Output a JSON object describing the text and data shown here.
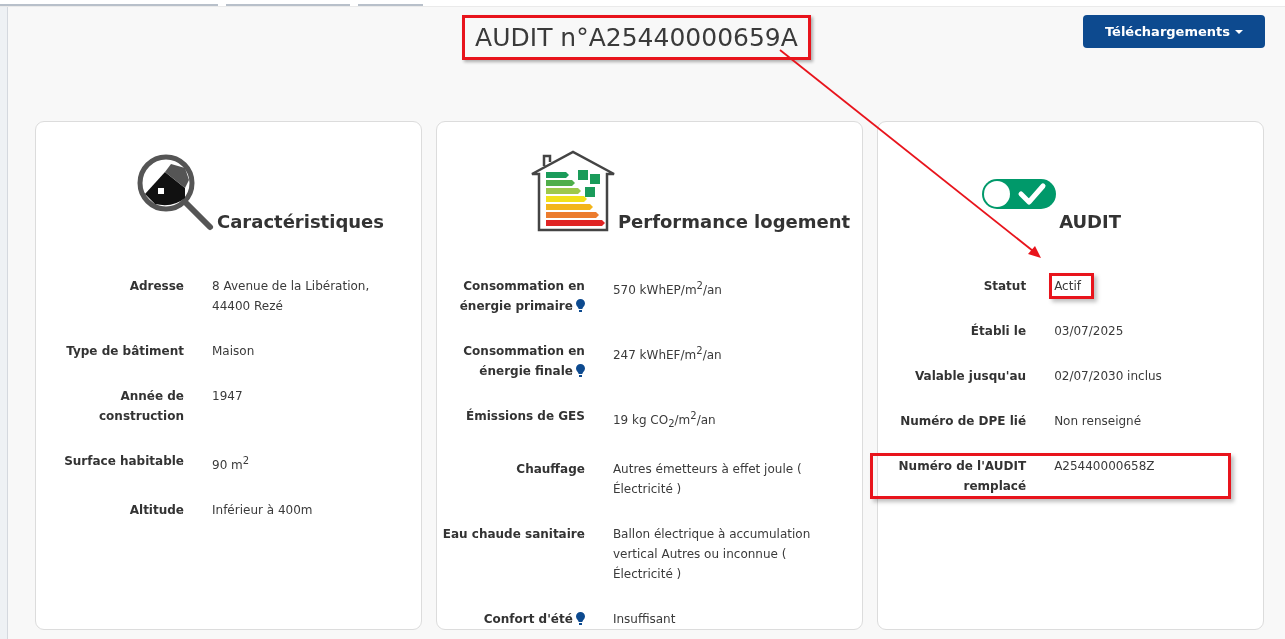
{
  "title": {
    "text": "AUDIT n°A25440000659A",
    "highlighted": true
  },
  "download_button": {
    "label": "Téléchargements"
  },
  "cards": [
    {
      "kind": "search-house",
      "title": "Caractéristiques",
      "rows": [
        {
          "label": "Adresse",
          "value": "8 Avenue de la Libération, 44400 Rezé",
          "hint_icon": false,
          "value_highlighted": false,
          "row_highlighted": false
        },
        {
          "label": "Type de bâtiment",
          "value": "Maison",
          "hint_icon": false,
          "value_highlighted": false,
          "row_highlighted": false
        },
        {
          "label": "Année de construction",
          "value": "1947",
          "hint_icon": false,
          "value_highlighted": false,
          "row_highlighted": false
        },
        {
          "label": "Surface habitable",
          "value": "90 m$^{2}$",
          "hint_icon": false,
          "value_highlighted": false,
          "row_highlighted": false
        },
        {
          "label": "Altitude",
          "value": "Inférieur à 400m",
          "hint_icon": false,
          "value_highlighted": false,
          "row_highlighted": false
        }
      ]
    },
    {
      "kind": "energy-label",
      "title": "Performance logement",
      "rows": [
        {
          "label": "Consommation en énergie primaire",
          "value": "570 kWhEP/m$^{2}$/an",
          "hint_icon": true,
          "value_highlighted": false,
          "row_highlighted": false
        },
        {
          "label": "Consommation en énergie finale",
          "value": "247 kWhEF/m$^{2}$/an",
          "hint_icon": true,
          "value_highlighted": false,
          "row_highlighted": false
        },
        {
          "label": "Émissions de GES",
          "value": "19 kg CO$_{2}$/m$^{2}$/an",
          "hint_icon": false,
          "value_highlighted": false,
          "row_highlighted": false
        },
        {
          "label": "Chauffage",
          "value": "Autres émetteurs à effet joule ( Électricité )",
          "hint_icon": false,
          "value_highlighted": false,
          "row_highlighted": false
        },
        {
          "label": "Eau chaude sanitaire",
          "value": "Ballon électrique à accumulation vertical Autres ou inconnue ( Électricité )",
          "hint_icon": false,
          "value_highlighted": false,
          "row_highlighted": false
        },
        {
          "label": "Confort d'été",
          "value": "Insuffisant",
          "hint_icon": true,
          "value_highlighted": false,
          "row_highlighted": false
        }
      ]
    },
    {
      "kind": "toggle-check",
      "title": "AUDIT",
      "rows": [
        {
          "label": "Statut",
          "value": "Actif",
          "hint_icon": false,
          "value_highlighted": true,
          "row_highlighted": false
        },
        {
          "label": "Établi le",
          "value": "03/07/2025",
          "hint_icon": false,
          "value_highlighted": false,
          "row_highlighted": false
        },
        {
          "label": "Valable jusqu'au",
          "value": "02/07/2030 inclus",
          "hint_icon": false,
          "value_highlighted": false,
          "row_highlighted": false
        },
        {
          "label": "Numéro de DPE lié",
          "value": "Non renseigné",
          "hint_icon": false,
          "value_highlighted": false,
          "row_highlighted": false
        },
        {
          "label": "Numéro de l'AUDIT remplacé",
          "value": "A25440000658Z",
          "hint_icon": false,
          "value_highlighted": false,
          "row_highlighted": true
        }
      ]
    }
  ]
}
